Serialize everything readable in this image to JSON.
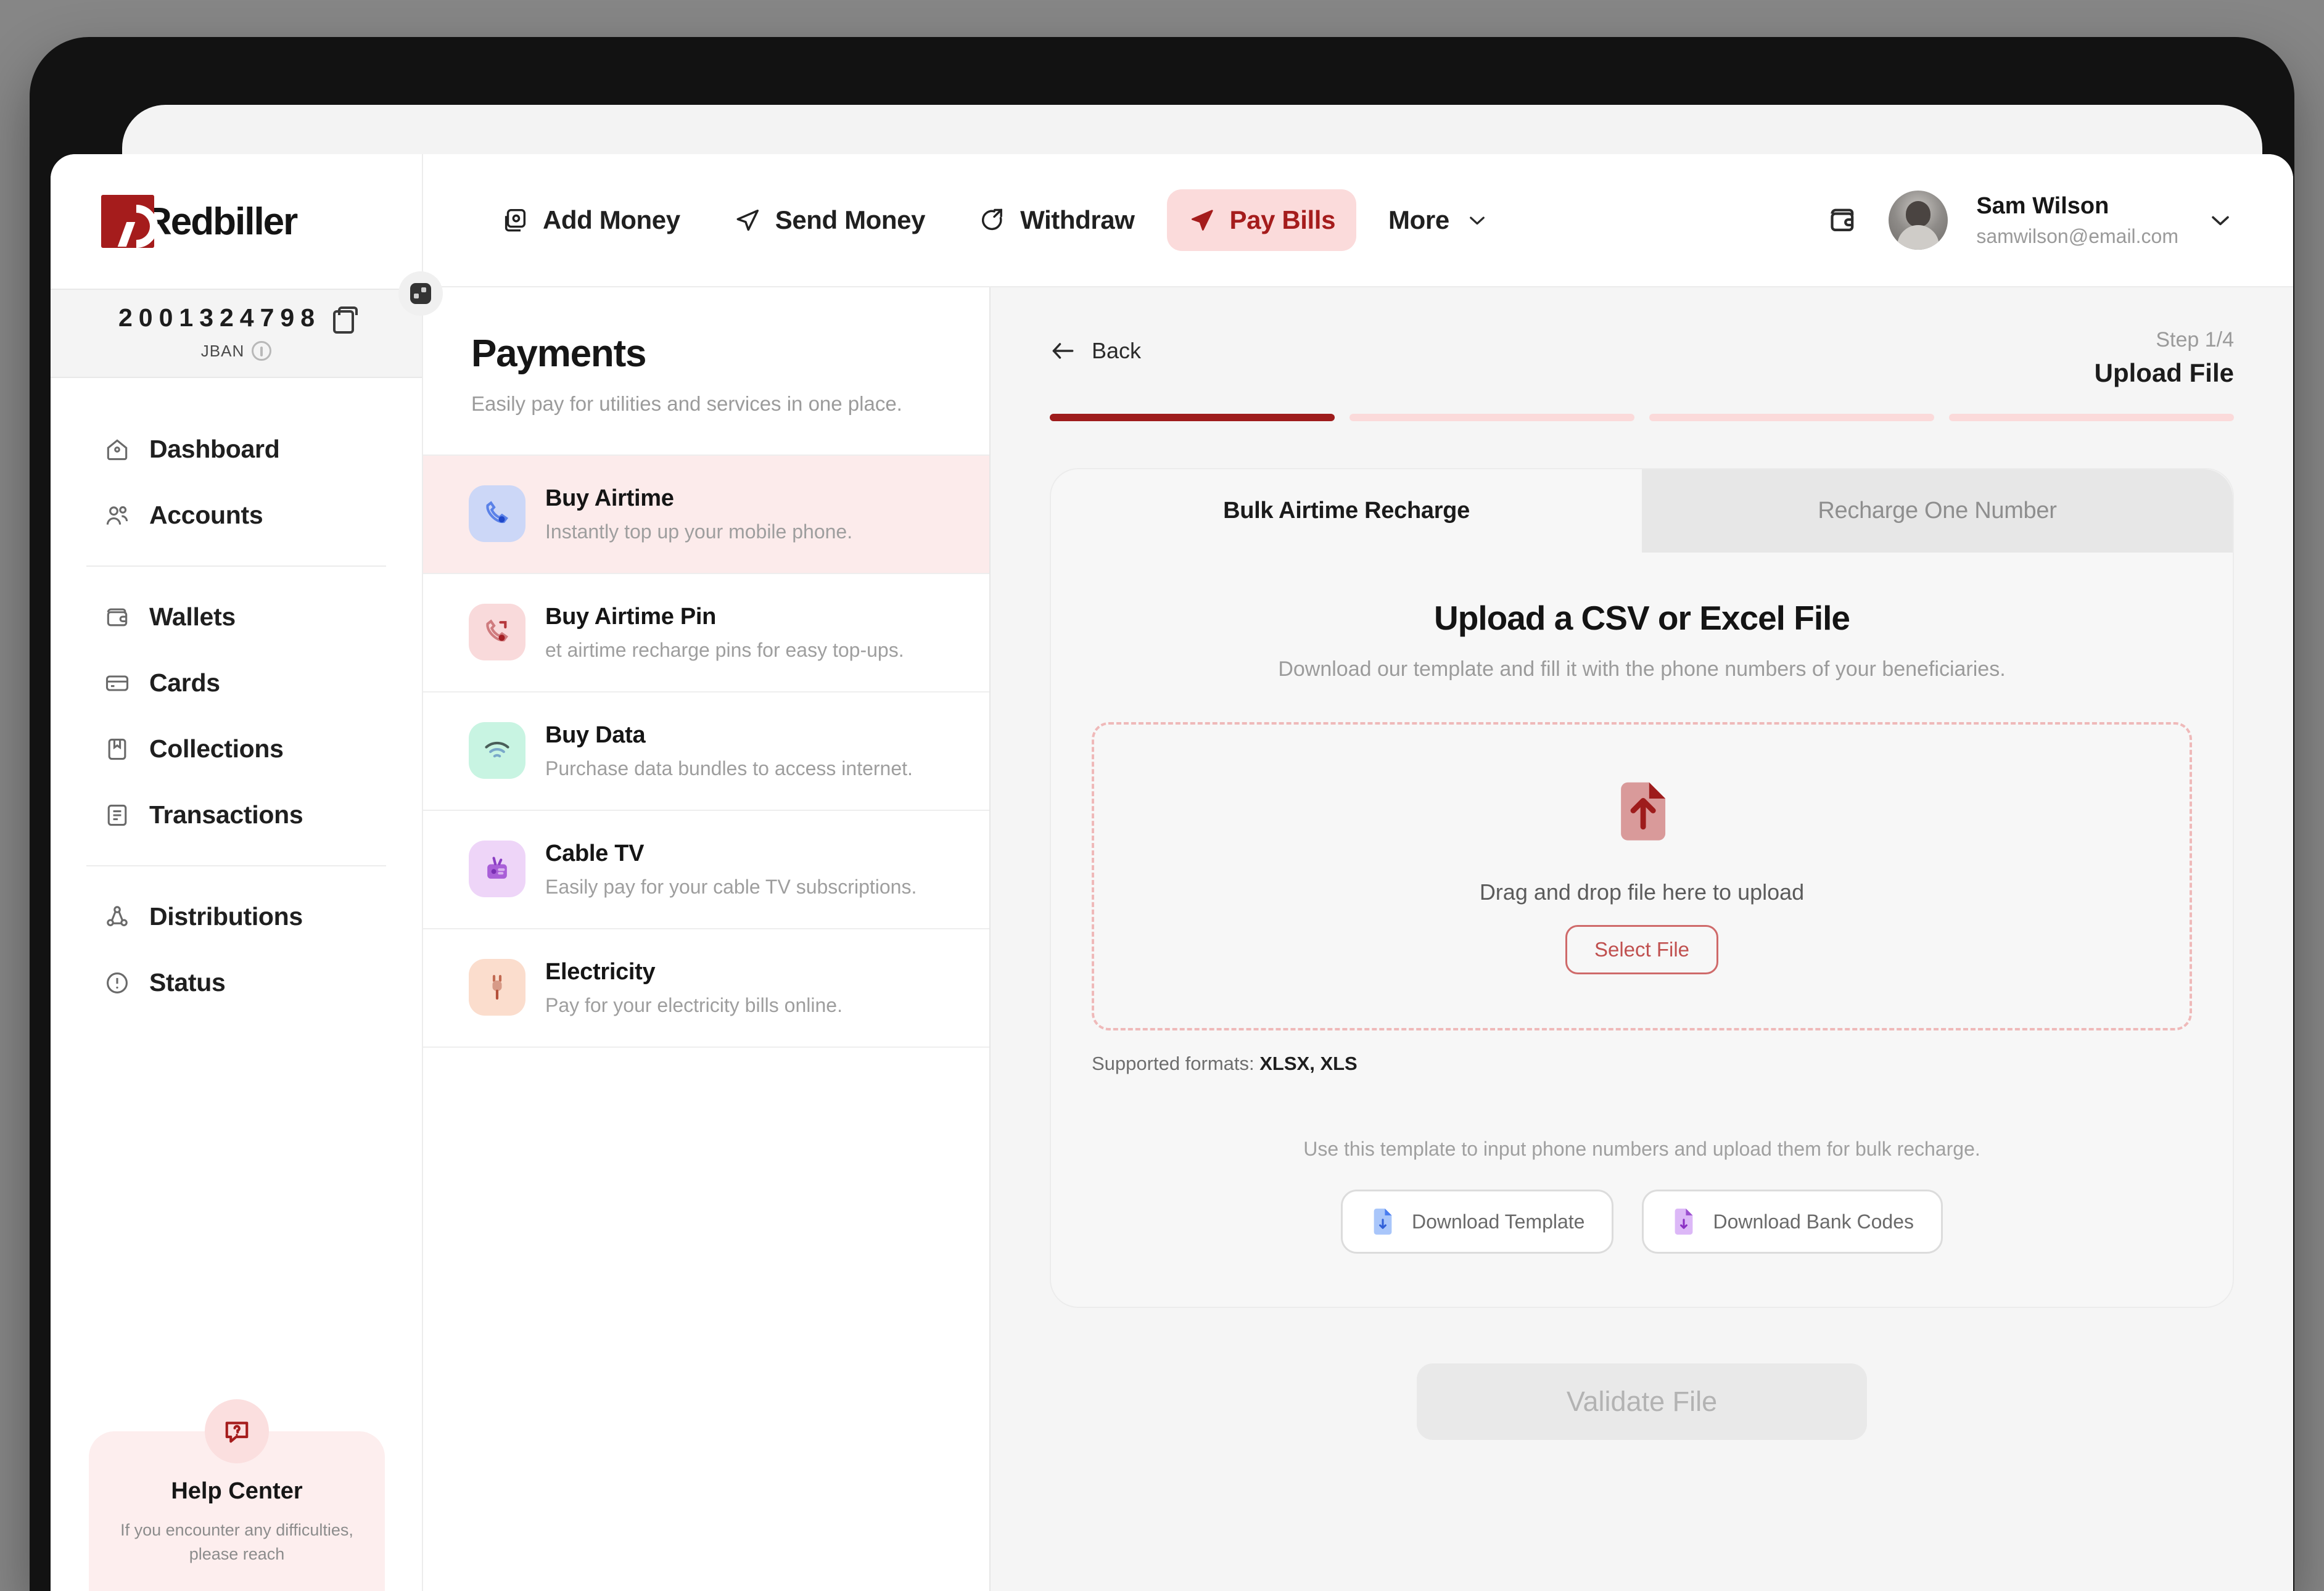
{
  "brand": {
    "name": "Redbiller",
    "primary_color": "#a51c1c",
    "accent_bg": "#fbdbdb"
  },
  "sidebar": {
    "account": {
      "number": "2001324798",
      "copy_icon": "copy-icon",
      "type_label": "JBAN",
      "info_icon": "info-icon"
    },
    "nav_groups": [
      {
        "items": [
          {
            "label": "Dashboard",
            "icon": "home-icon"
          },
          {
            "label": "Accounts",
            "icon": "users-icon"
          }
        ]
      },
      {
        "items": [
          {
            "label": "Wallets",
            "icon": "wallet-icon"
          },
          {
            "label": "Cards",
            "icon": "card-icon"
          },
          {
            "label": "Collections",
            "icon": "collections-icon"
          },
          {
            "label": "Transactions",
            "icon": "transactions-icon"
          }
        ]
      },
      {
        "items": [
          {
            "label": "Distributions",
            "icon": "distributions-icon"
          },
          {
            "label": "Status",
            "icon": "status-icon"
          }
        ]
      }
    ],
    "help_card": {
      "icon": "question-chat-icon",
      "title": "Help Center",
      "text": "If you encounter any difficulties, please reach"
    },
    "collapse_toggle_icon": "sidebar-collapse-icon"
  },
  "topbar": {
    "nav": [
      {
        "label": "Add Money",
        "icon": "add-money-icon",
        "active": false
      },
      {
        "label": "Send Money",
        "icon": "send-money-icon",
        "active": false
      },
      {
        "label": "Withdraw",
        "icon": "withdraw-icon",
        "active": false
      },
      {
        "label": "Pay Bills",
        "icon": "pay-bills-icon",
        "active": true
      }
    ],
    "more_label": "More",
    "more_chevron_icon": "chevron-down-icon",
    "wallet_icon": "wallet-top-icon",
    "user": {
      "name": "Sam Wilson",
      "email": "samwilson@email.com",
      "avatar": "user-avatar",
      "chevron_icon": "chevron-down-icon"
    }
  },
  "payments": {
    "title": "Payments",
    "subtitle": "Easily pay for utilities and services in one place.",
    "services": [
      {
        "title": "Buy Airtime",
        "desc": "Instantly top up your mobile phone.",
        "icon": "phone-icon",
        "icon_bg": "#ccd7f7",
        "icon_color": "#2f5fd8",
        "active": true
      },
      {
        "title": "Buy Airtime Pin",
        "desc": "et airtime recharge pins for easy top-ups.",
        "icon": "phone-pin-icon",
        "icon_bg": "#f9dadb",
        "icon_color": "#b5383c",
        "active": false
      },
      {
        "title": "Buy Data",
        "desc": "Purchase data bundles to access internet.",
        "icon": "wifi-icon",
        "icon_bg": "#c8f4e2",
        "icon_color": "#2f7f66",
        "active": false
      },
      {
        "title": "Cable TV",
        "desc": "Easily pay for your cable TV subscriptions.",
        "icon": "tv-icon",
        "icon_bg": "#eed5f8",
        "icon_color": "#9b4fd0",
        "active": false
      },
      {
        "title": "Electricity",
        "desc": "Pay for your electricity bills online.",
        "icon": "plug-icon",
        "icon_bg": "#fbddcd",
        "icon_color": "#c26a52",
        "active": false
      }
    ]
  },
  "main": {
    "back_label": "Back",
    "back_icon": "arrow-left-icon",
    "step_count": "Step 1/4",
    "step_name": "Upload File",
    "progress": {
      "total": 4,
      "completed": 1
    },
    "tabs": [
      {
        "label": "Bulk Airtime Recharge",
        "active": true
      },
      {
        "label": "Recharge One Number",
        "active": false
      }
    ],
    "heading": "Upload a CSV or Excel File",
    "subheading": "Download our template and fill it with the phone numbers of your beneficiaries.",
    "dropzone": {
      "icon": "file-upload-icon",
      "text": "Drag and drop file here to upload",
      "button_label": "Select File"
    },
    "formats_prefix": "Supported formats: ",
    "formats_value": "XLSX, XLS",
    "template_note": "Use this template to input phone numbers and upload them for bulk recharge.",
    "downloads": [
      {
        "label": "Download Template",
        "icon": "file-blue-icon",
        "color": "#5b8def"
      },
      {
        "label": "Download Bank Codes",
        "icon": "file-purple-icon",
        "color": "#a855f7"
      }
    ],
    "submit_label": "Validate File"
  }
}
